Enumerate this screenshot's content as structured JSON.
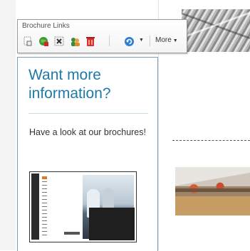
{
  "toolbar": {
    "title": "Brochure Links",
    "buttons": [
      {
        "icon": "page-properties-icon"
      },
      {
        "icon": "globe-link-icon"
      },
      {
        "icon": "unlink-icon"
      },
      {
        "icon": "users-icon"
      },
      {
        "icon": "delete-icon"
      },
      {
        "icon": "refresh-icon"
      }
    ],
    "more_label": "More"
  },
  "info": {
    "title": "Want more information?",
    "text": "Have a look at our brochures!"
  },
  "colors": {
    "title_blue": "#1f79a8",
    "box_border": "#7f9db6"
  }
}
